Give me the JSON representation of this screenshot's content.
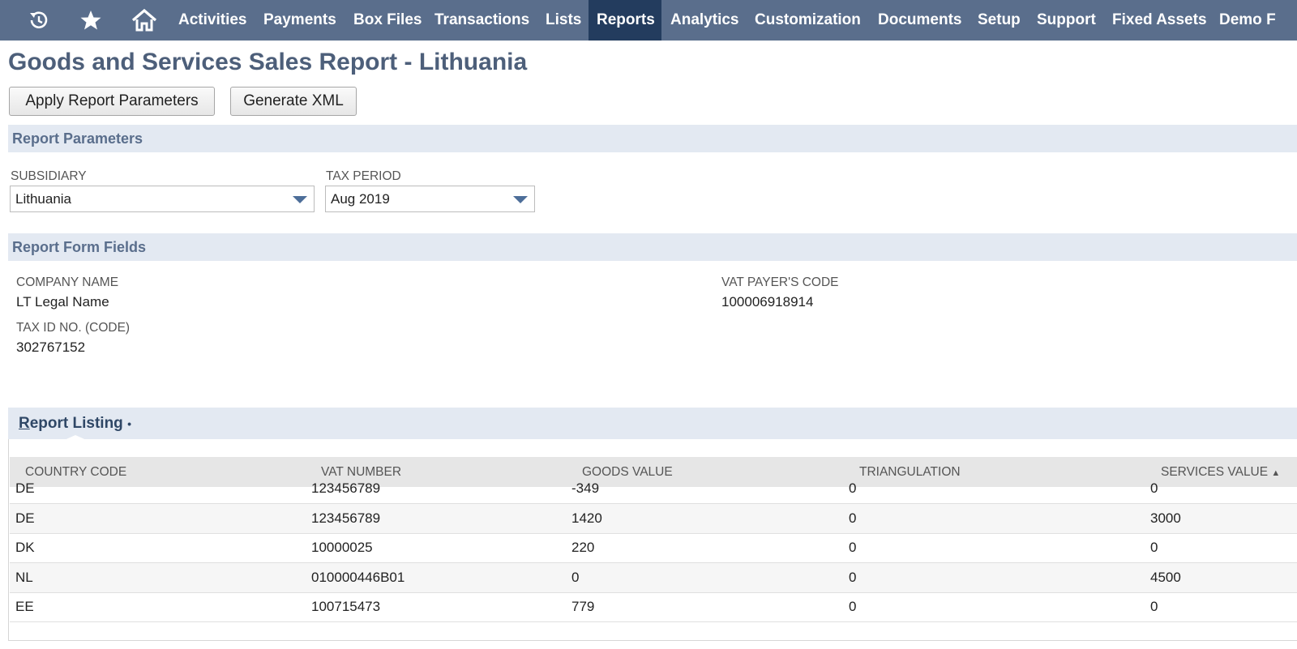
{
  "nav": {
    "icons": [
      "recent-icon",
      "star-icon",
      "home-icon"
    ],
    "items": [
      {
        "label": "Activities",
        "active": false
      },
      {
        "label": "Payments",
        "active": false
      },
      {
        "label": "Box Files",
        "active": false
      },
      {
        "label": "Transactions",
        "active": false
      },
      {
        "label": "Lists",
        "active": false
      },
      {
        "label": "Reports",
        "active": true
      },
      {
        "label": "Analytics",
        "active": false
      },
      {
        "label": "Customization",
        "active": false
      },
      {
        "label": "Documents",
        "active": false
      },
      {
        "label": "Setup",
        "active": false
      },
      {
        "label": "Support",
        "active": false
      },
      {
        "label": "Fixed Assets",
        "active": false
      },
      {
        "label": "Demo F",
        "active": false
      }
    ]
  },
  "page": {
    "title": "Goods and Services Sales Report - Lithuania"
  },
  "buttons": {
    "apply": "Apply Report Parameters",
    "generate": "Generate XML"
  },
  "parameters": {
    "section_title": "Report Parameters",
    "subsidiary_label": "SUBSIDIARY",
    "subsidiary_value": "Lithuania",
    "tax_period_label": "TAX PERIOD",
    "tax_period_value": "Aug 2019"
  },
  "form_fields": {
    "section_title": "Report Form Fields",
    "company_name_label": "COMPANY NAME",
    "company_name_value": "LT Legal Name",
    "tax_id_label": "TAX ID NO. (CODE)",
    "tax_id_value": "302767152",
    "vat_payer_label": "VAT PAYER'S CODE",
    "vat_payer_value": "100006918914"
  },
  "listing": {
    "tab_first_letter": "R",
    "tab_rest": "eport Listing",
    "tab_dot": "•",
    "columns": [
      "COUNTRY CODE",
      "VAT NUMBER",
      "GOODS VALUE",
      "TRIANGULATION",
      "SERVICES VALUE"
    ],
    "sort_indicator": "▲",
    "rows": [
      [
        "DE",
        "123456789",
        "-349",
        "0",
        "0"
      ],
      [
        "DE",
        "123456789",
        "1420",
        "0",
        "3000"
      ],
      [
        "DK",
        "10000025",
        "220",
        "0",
        "0"
      ],
      [
        "NL",
        "010000446B01",
        "0",
        "0",
        "4500"
      ],
      [
        "EE",
        "100715473",
        "779",
        "0",
        "0"
      ]
    ]
  },
  "colors": {
    "navbar": "#5a6e8c",
    "navbar_active": "#233c5e",
    "title": "#4d5f7a",
    "section_bar": "#e3e9f2"
  }
}
